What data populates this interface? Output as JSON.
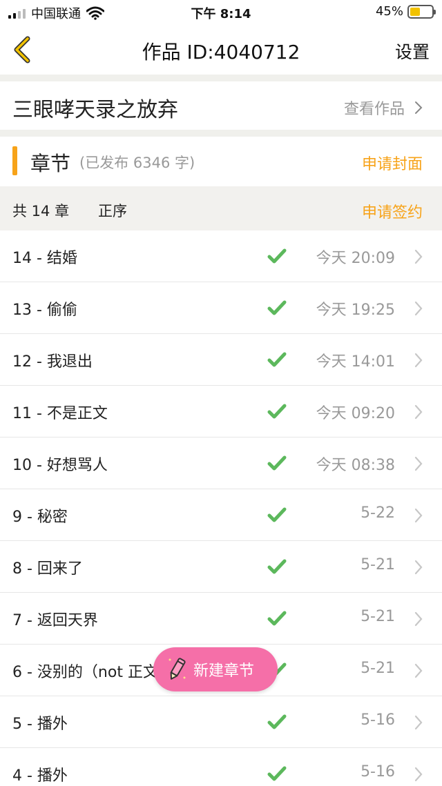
{
  "status_bar": {
    "carrier": "中国联通",
    "time": "下午 8:14",
    "battery_text": "45%",
    "battery_level": 0.45
  },
  "nav": {
    "title": "作品 ID:4040712",
    "settings_label": "设置",
    "back_icon": "chevron-left-icon"
  },
  "work": {
    "title": "三眼哮天录之放弃",
    "view_label": "查看作品"
  },
  "chapters_header": {
    "label": "章节",
    "meta": "(已发布 6346 字)",
    "apply_cover_label": "申请封面"
  },
  "toolbar": {
    "count_label": "共 14 章",
    "order_label": "正序",
    "apply_sign_label": "申请签约"
  },
  "chapters": [
    {
      "title": "14 - 结婚",
      "time": "今天 20:09"
    },
    {
      "title": "13 - 偷偷",
      "time": "今天 19:25"
    },
    {
      "title": "12 - 我退出",
      "time": "今天 14:01"
    },
    {
      "title": "11 - 不是正文",
      "time": "今天 09:20"
    },
    {
      "title": "10 - 好想骂人",
      "time": "今天 08:38"
    },
    {
      "title": "9 - 秘密",
      "time": "5-22"
    },
    {
      "title": "8 - 回来了",
      "time": "5-21"
    },
    {
      "title": "7 - 返回天界",
      "time": "5-21"
    },
    {
      "title": "6 - 没别的（not 正文）",
      "time": "5-21"
    },
    {
      "title": "5 - 播外",
      "time": "5-16"
    },
    {
      "title": "4 - 播外",
      "time": "5-16"
    }
  ],
  "fab": {
    "label": "新建章节"
  },
  "colors": {
    "accent": "#f7a319",
    "check": "#5cb85c",
    "fab": "#f56fa8"
  }
}
